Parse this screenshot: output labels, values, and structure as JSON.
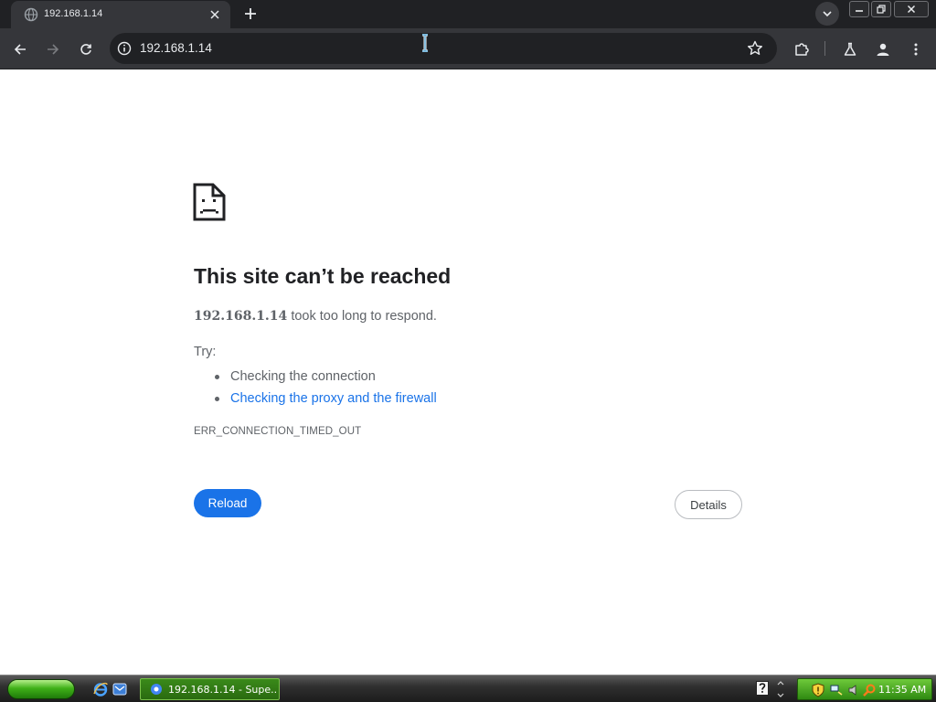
{
  "browser": {
    "tab": {
      "title": "192.168.1.14",
      "favicon": "globe-icon"
    },
    "address_bar": {
      "url": "192.168.1.14"
    }
  },
  "page": {
    "title": "This site can’t be reached",
    "summary_host": "192.168.1.14",
    "summary_text": " took too long to respond.",
    "try_label": "Try:",
    "suggestions": [
      {
        "text": "Checking the connection",
        "is_link": false
      },
      {
        "text": "Checking the proxy and the firewall",
        "is_link": true
      }
    ],
    "error_code": "ERR_CONNECTION_TIMED_OUT",
    "reload_label": "Reload",
    "details_label": "Details"
  },
  "taskbar": {
    "task_label": "192.168.1.14 - Supe...",
    "clock": "11:35 AM"
  },
  "colors": {
    "accent": "#1a73e8",
    "chrome_dark": "#202124",
    "toolbar": "#35363a",
    "text_secondary": "#5f6368"
  }
}
